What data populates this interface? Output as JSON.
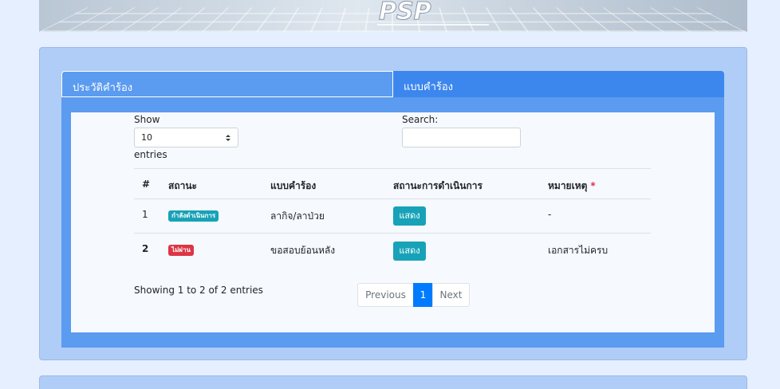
{
  "banner": {
    "logo_text": "PSP"
  },
  "tabs": [
    {
      "label": "ประวัติคำร้อง"
    },
    {
      "label": "แบบคำร้อง"
    }
  ],
  "length_control": {
    "show_label": "Show",
    "value": "10",
    "entries_label": "entries"
  },
  "search": {
    "label": "Search:",
    "value": ""
  },
  "table": {
    "headers": {
      "num": "#",
      "status": "สถานะ",
      "form": "แบบคำร้อง",
      "process": "สถานะการดำเนินการ",
      "note": "หมายเหตุ",
      "required_mark": "*"
    },
    "rows": [
      {
        "num": "1",
        "status": "กำลังดำเนินการ",
        "status_color": "#17a2b8",
        "form": "ลากิจ/ลาป่วย",
        "action": "แสดง",
        "note": "-"
      },
      {
        "num": "2",
        "status": "ไม่ผ่าน",
        "status_color": "#dc3545",
        "form": "ขอสอบย้อนหลัง",
        "action": "แสดง",
        "note": "เอกสารไม่ครบ"
      }
    ]
  },
  "info": "Showing 1 to 2 of 2 entries",
  "pagination": {
    "previous": "Previous",
    "current": "1",
    "next": "Next"
  },
  "colors": {
    "primary_tab": "#3c87ee",
    "info": "#17a2b8",
    "danger": "#dc3545",
    "page_active": "#007bff"
  }
}
